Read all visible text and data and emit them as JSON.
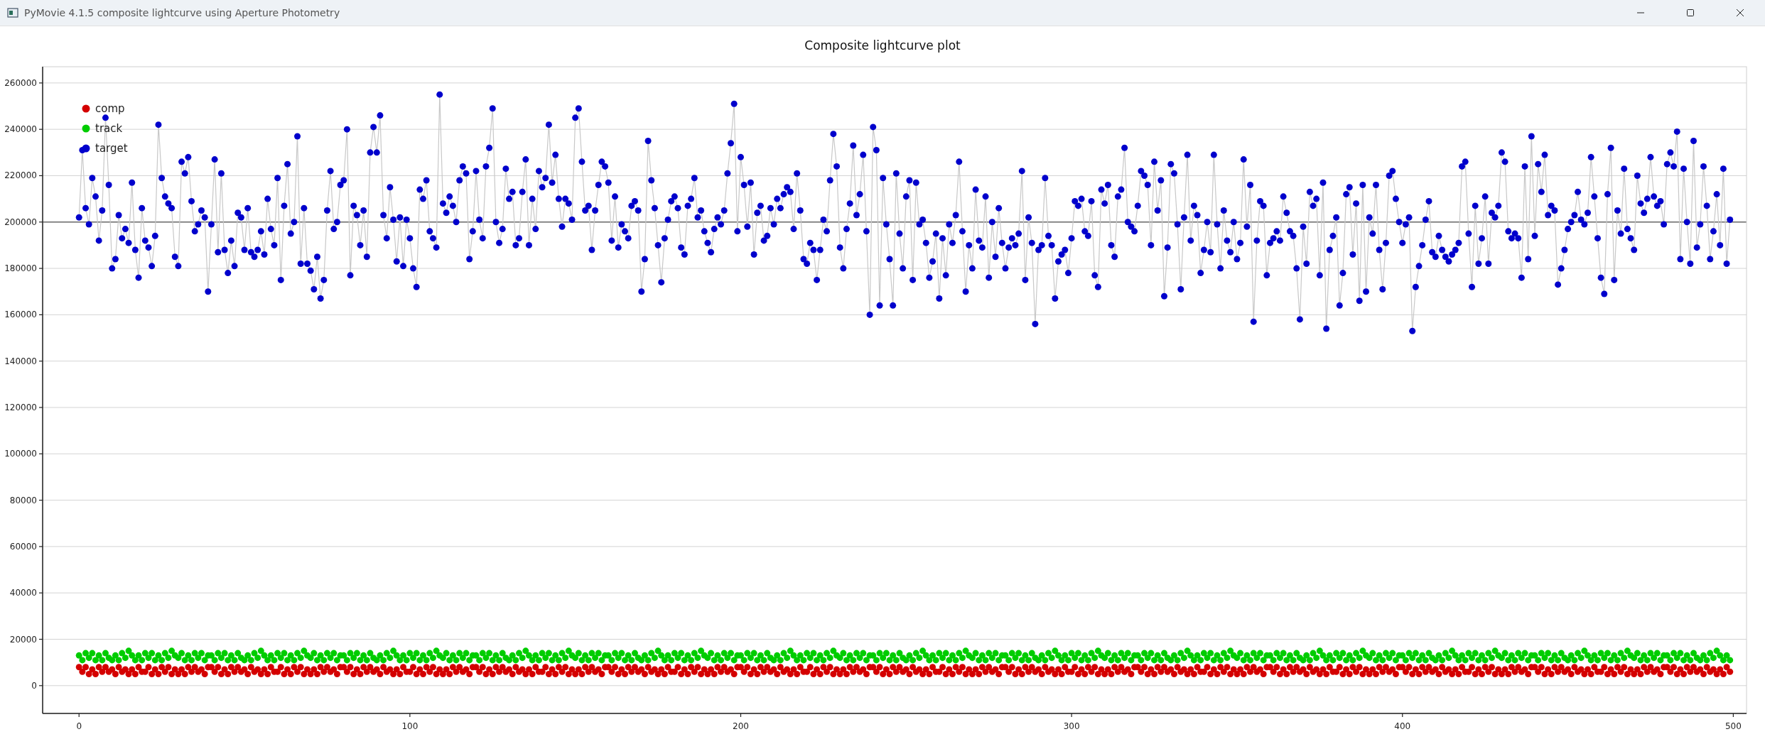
{
  "window": {
    "title": "PyMovie 4.1.5 composite lightcurve using Aperture Photometry"
  },
  "chart": {
    "chart_data": {
      "type": "scatter",
      "title": "Composite lightcurve plot",
      "grid": true,
      "xlim": [
        -11,
        504
      ],
      "ylim": [
        -12000,
        267000
      ],
      "xticks": [
        0,
        100,
        200,
        300,
        400,
        500
      ],
      "yticks": [
        0,
        20000,
        40000,
        60000,
        80000,
        100000,
        120000,
        140000,
        160000,
        180000,
        200000,
        220000,
        240000,
        260000
      ],
      "ref_lines": [
        {
          "axis": "y",
          "value": 200000
        }
      ],
      "legend": true,
      "x": [
        0,
        1,
        2,
        3,
        4,
        5,
        6,
        7,
        8,
        9,
        10,
        11,
        12,
        13,
        14,
        15,
        16,
        17,
        18,
        19,
        20,
        21,
        22,
        23,
        24,
        25,
        26,
        27,
        28,
        29,
        30,
        31,
        32,
        33,
        34,
        35,
        36,
        37,
        38,
        39,
        40,
        41,
        42,
        43,
        44,
        45,
        46,
        47,
        48,
        49,
        50,
        51,
        52,
        53,
        54,
        55,
        56,
        57,
        58,
        59,
        60,
        61,
        62,
        63,
        64,
        65,
        66,
        67,
        68,
        69,
        70,
        71,
        72,
        73,
        74,
        75,
        76,
        77,
        78,
        79,
        80,
        81,
        82,
        83,
        84,
        85,
        86,
        87,
        88,
        89,
        90,
        91,
        92,
        93,
        94,
        95,
        96,
        97,
        98,
        99,
        100,
        101,
        102,
        103,
        104,
        105,
        106,
        107,
        108,
        109,
        110,
        111,
        112,
        113,
        114,
        115,
        116,
        117,
        118,
        119,
        120,
        121,
        122,
        123,
        124,
        125,
        126,
        127,
        128,
        129,
        130,
        131,
        132,
        133,
        134,
        135,
        136,
        137,
        138,
        139,
        140,
        141,
        142,
        143,
        144,
        145,
        146,
        147,
        148,
        149,
        150,
        151,
        152,
        153,
        154,
        155,
        156,
        157,
        158,
        159,
        160,
        161,
        162,
        163,
        164,
        165,
        166,
        167,
        168,
        169,
        170,
        171,
        172,
        173,
        174,
        175,
        176,
        177,
        178,
        179,
        180,
        181,
        182,
        183,
        184,
        185,
        186,
        187,
        188,
        189,
        190,
        191,
        192,
        193,
        194,
        195,
        196,
        197,
        198,
        199,
        200,
        201,
        202,
        203,
        204,
        205,
        206,
        207,
        208,
        209,
        210,
        211,
        212,
        213,
        214,
        215,
        216,
        217,
        218,
        219,
        220,
        221,
        222,
        223,
        224,
        225,
        226,
        227,
        228,
        229,
        230,
        231,
        232,
        233,
        234,
        235,
        236,
        237,
        238,
        239,
        240,
        241,
        242,
        243,
        244,
        245,
        246,
        247,
        248,
        249,
        250,
        251,
        252,
        253,
        254,
        255,
        256,
        257,
        258,
        259,
        260,
        261,
        262,
        263,
        264,
        265,
        266,
        267,
        268,
        269,
        270,
        271,
        272,
        273,
        274,
        275,
        276,
        277,
        278,
        279,
        280,
        281,
        282,
        283,
        284,
        285,
        286,
        287,
        288,
        289,
        290,
        291,
        292,
        293,
        294,
        295,
        296,
        297,
        298,
        299,
        300,
        301,
        302,
        303,
        304,
        305,
        306,
        307,
        308,
        309,
        310,
        311,
        312,
        313,
        314,
        315,
        316,
        317,
        318,
        319,
        320,
        321,
        322,
        323,
        324,
        325,
        326,
        327,
        328,
        329,
        330,
        331,
        332,
        333,
        334,
        335,
        336,
        337,
        338,
        339,
        340,
        341,
        342,
        343,
        344,
        345,
        346,
        347,
        348,
        349,
        350,
        351,
        352,
        353,
        354,
        355,
        356,
        357,
        358,
        359,
        360,
        361,
        362,
        363,
        364,
        365,
        366,
        367,
        368,
        369,
        370,
        371,
        372,
        373,
        374,
        375,
        376,
        377,
        378,
        379,
        380,
        381,
        382,
        383,
        384,
        385,
        386,
        387,
        388,
        389,
        390,
        391,
        392,
        393,
        394,
        395,
        396,
        397,
        398,
        399,
        400,
        401,
        402,
        403,
        404,
        405,
        406,
        407,
        408,
        409,
        410,
        411,
        412,
        413,
        414,
        415,
        416,
        417,
        418,
        419,
        420,
        421,
        422,
        423,
        424,
        425,
        426,
        427,
        428,
        429,
        430,
        431,
        432,
        433,
        434,
        435,
        436,
        437,
        438,
        439,
        440,
        441,
        442,
        443,
        444,
        445,
        446,
        447,
        448,
        449,
        450,
        451,
        452,
        453,
        454,
        455,
        456,
        457,
        458,
        459,
        460,
        461,
        462,
        463,
        464,
        465,
        466,
        467,
        468,
        469,
        470,
        471,
        472,
        473,
        474,
        475,
        476,
        477,
        478,
        479,
        480,
        481,
        482,
        483,
        484,
        485,
        486,
        487,
        488,
        489,
        490,
        491,
        492,
        493,
        494,
        495,
        496,
        497,
        498,
        499
      ],
      "series": [
        {
          "name": "comp",
          "color": "#d40000",
          "type": "scatter",
          "marker": "o",
          "values": [
            8000,
            6000,
            8000,
            5000,
            7000,
            5000,
            8000,
            6000,
            8000,
            6000,
            7000,
            5000,
            8000,
            6000,
            7000,
            5000,
            7000,
            5000,
            8000,
            6000,
            6000,
            8000,
            5000,
            7000,
            5000,
            8000,
            6000,
            8000,
            5000,
            7000,
            5000,
            7000,
            5000,
            8000,
            6000,
            8000,
            6000,
            7000,
            5000,
            8000,
            8000,
            6000,
            8000,
            5000,
            7000,
            5000,
            8000,
            6000,
            8000,
            6000,
            7000,
            5000,
            8000,
            6000,
            7000,
            5000,
            7000,
            5000,
            8000,
            6000,
            6000,
            8000,
            5000,
            7000,
            5000,
            8000,
            6000,
            8000,
            5000,
            7000,
            5000,
            7000,
            5000,
            8000,
            6000,
            8000,
            6000,
            7000,
            5000,
            8000,
            8000,
            6000,
            8000,
            5000,
            7000,
            5000,
            8000,
            6000,
            8000,
            6000,
            7000,
            5000,
            8000,
            6000,
            7000,
            5000,
            7000,
            5000,
            8000,
            6000,
            6000,
            8000,
            5000,
            7000,
            5000,
            8000,
            6000,
            8000,
            5000,
            7000,
            5000,
            7000,
            5000,
            8000,
            6000,
            8000,
            6000,
            7000,
            5000,
            8000,
            8000,
            6000,
            8000,
            5000,
            7000,
            5000,
            8000,
            6000,
            8000,
            6000,
            7000,
            5000,
            8000,
            6000,
            7000,
            5000,
            7000,
            5000,
            8000,
            6000,
            6000,
            8000,
            5000,
            7000,
            5000,
            8000,
            6000,
            8000,
            5000,
            7000,
            5000,
            7000,
            5000,
            8000,
            6000,
            8000,
            6000,
            7000,
            5000,
            8000,
            8000,
            6000,
            8000,
            5000,
            7000,
            5000,
            8000,
            6000,
            8000,
            6000,
            7000,
            5000,
            8000,
            6000,
            7000,
            5000,
            7000,
            5000,
            8000,
            6000,
            6000,
            8000,
            5000,
            7000,
            5000,
            8000,
            6000,
            8000,
            5000,
            7000,
            5000,
            7000,
            5000,
            8000,
            6000,
            8000,
            6000,
            7000,
            5000,
            8000,
            8000,
            6000,
            8000,
            5000,
            7000,
            5000,
            8000,
            6000,
            8000,
            6000,
            7000,
            5000,
            8000,
            6000,
            7000,
            5000,
            7000,
            5000,
            8000,
            6000,
            6000,
            8000,
            5000,
            7000,
            5000,
            8000,
            6000,
            8000,
            5000,
            7000,
            5000,
            7000,
            5000,
            8000,
            6000,
            8000,
            6000,
            7000,
            5000,
            8000,
            8000,
            6000,
            8000,
            5000,
            7000,
            5000,
            8000,
            6000,
            8000,
            6000,
            7000,
            5000,
            8000,
            6000,
            7000,
            5000,
            7000,
            5000,
            8000,
            6000,
            6000,
            8000,
            5000,
            7000,
            5000,
            8000,
            6000,
            8000,
            5000,
            7000,
            5000,
            7000,
            5000,
            8000,
            6000,
            8000,
            6000,
            7000,
            5000,
            8000,
            8000,
            6000,
            8000,
            5000,
            7000,
            5000,
            8000,
            6000,
            8000,
            6000,
            7000,
            5000,
            8000,
            6000,
            7000,
            5000,
            7000,
            5000,
            8000,
            6000,
            6000,
            8000,
            5000,
            7000,
            5000,
            8000,
            6000,
            8000,
            5000,
            7000,
            5000,
            7000,
            5000,
            8000,
            6000,
            8000,
            6000,
            7000,
            5000,
            8000,
            8000,
            6000,
            8000,
            5000,
            7000,
            5000,
            8000,
            6000,
            8000,
            6000,
            7000,
            5000,
            8000,
            6000,
            7000,
            5000,
            7000,
            5000,
            8000,
            6000,
            6000,
            8000,
            5000,
            7000,
            5000,
            8000,
            6000,
            8000,
            5000,
            7000,
            5000,
            7000,
            5000,
            8000,
            6000,
            8000,
            6000,
            7000,
            5000,
            8000,
            8000,
            6000,
            8000,
            5000,
            7000,
            5000,
            8000,
            6000,
            8000,
            6000,
            7000,
            5000,
            8000,
            6000,
            7000,
            5000,
            7000,
            5000,
            8000,
            6000,
            6000,
            8000,
            5000,
            7000,
            5000,
            8000,
            6000,
            8000,
            5000,
            7000,
            5000,
            7000,
            5000,
            8000,
            6000,
            8000,
            6000,
            7000,
            5000,
            8000,
            8000,
            6000,
            8000,
            5000,
            7000,
            5000,
            8000,
            6000,
            8000,
            6000,
            7000,
            5000,
            8000,
            6000,
            7000,
            5000,
            7000,
            5000,
            8000,
            6000,
            6000,
            8000,
            5000,
            7000,
            5000,
            8000,
            6000,
            8000,
            5000,
            7000,
            5000,
            7000,
            5000,
            8000,
            6000,
            8000,
            6000,
            7000,
            5000,
            8000,
            8000,
            6000,
            8000,
            5000,
            7000,
            5000,
            8000,
            6000,
            8000,
            6000,
            7000,
            5000,
            8000,
            6000,
            7000,
            5000,
            7000,
            5000,
            8000,
            6000,
            6000,
            8000,
            5000,
            7000,
            5000,
            8000,
            6000,
            8000,
            5000,
            7000,
            5000,
            7000,
            5000,
            8000,
            6000,
            8000,
            6000,
            7000,
            5000,
            8000,
            8000,
            6000,
            8000,
            5000,
            7000,
            5000,
            8000,
            6000,
            8000,
            6000,
            7000,
            5000,
            8000,
            6000,
            7000,
            5000,
            7000,
            5000,
            8000,
            6000
          ]
        },
        {
          "name": "track",
          "color": "#00cc00",
          "type": "scatter",
          "marker": "o",
          "values": [
            13000,
            11000,
            14000,
            12000,
            14000,
            11000,
            13000,
            11000,
            14000,
            12000,
            11000,
            13000,
            11000,
            14000,
            12000,
            15000,
            13000,
            11000,
            13000,
            11000,
            14000,
            12000,
            14000,
            11000,
            13000,
            11000,
            14000,
            12000,
            15000,
            13000,
            12000,
            14000,
            11000,
            13000,
            11000,
            14000,
            12000,
            14000,
            11000,
            13000,
            13000,
            11000,
            14000,
            12000,
            14000,
            11000,
            13000,
            11000,
            14000,
            12000,
            11000,
            13000,
            11000,
            14000,
            12000,
            15000,
            13000,
            11000,
            13000,
            11000,
            14000,
            12000,
            14000,
            11000,
            13000,
            11000,
            14000,
            12000,
            15000,
            13000,
            12000,
            14000,
            11000,
            13000,
            11000,
            14000,
            12000,
            14000,
            11000,
            13000,
            13000,
            11000,
            14000,
            12000,
            14000,
            11000,
            13000,
            11000,
            14000,
            12000,
            11000,
            13000,
            11000,
            14000,
            12000,
            15000,
            13000,
            11000,
            13000,
            11000,
            14000,
            12000,
            14000,
            11000,
            13000,
            11000,
            14000,
            12000,
            15000,
            13000,
            12000,
            14000,
            11000,
            13000,
            11000,
            14000,
            12000,
            14000,
            11000,
            13000,
            13000,
            11000,
            14000,
            12000,
            14000,
            11000,
            13000,
            11000,
            14000,
            12000,
            11000,
            13000,
            11000,
            14000,
            12000,
            15000,
            13000,
            11000,
            13000,
            11000,
            14000,
            12000,
            14000,
            11000,
            13000,
            11000,
            14000,
            12000,
            15000,
            13000,
            12000,
            14000,
            11000,
            13000,
            11000,
            14000,
            12000,
            14000,
            11000,
            13000,
            13000,
            11000,
            14000,
            12000,
            14000,
            11000,
            13000,
            11000,
            14000,
            12000,
            11000,
            13000,
            11000,
            14000,
            12000,
            15000,
            13000,
            11000,
            13000,
            11000,
            14000,
            12000,
            14000,
            11000,
            13000,
            11000,
            14000,
            12000,
            15000,
            13000,
            12000,
            14000,
            11000,
            13000,
            11000,
            14000,
            12000,
            14000,
            11000,
            13000,
            13000,
            11000,
            14000,
            12000,
            14000,
            11000,
            13000,
            11000,
            14000,
            12000,
            11000,
            13000,
            11000,
            14000,
            12000,
            15000,
            13000,
            11000,
            13000,
            11000,
            14000,
            12000,
            14000,
            11000,
            13000,
            11000,
            14000,
            12000,
            15000,
            13000,
            12000,
            14000,
            11000,
            13000,
            11000,
            14000,
            12000,
            14000,
            11000,
            13000,
            13000,
            11000,
            14000,
            12000,
            14000,
            11000,
            13000,
            11000,
            14000,
            12000,
            11000,
            13000,
            11000,
            14000,
            12000,
            15000,
            13000,
            11000,
            13000,
            11000,
            14000,
            12000,
            14000,
            11000,
            13000,
            11000,
            14000,
            12000,
            15000,
            13000,
            12000,
            14000,
            11000,
            13000,
            11000,
            14000,
            12000,
            14000,
            11000,
            13000,
            13000,
            11000,
            14000,
            12000,
            14000,
            11000,
            13000,
            11000,
            14000,
            12000,
            11000,
            13000,
            11000,
            14000,
            12000,
            15000,
            13000,
            11000,
            13000,
            11000,
            14000,
            12000,
            14000,
            11000,
            13000,
            11000,
            14000,
            12000,
            15000,
            13000,
            12000,
            14000,
            11000,
            13000,
            11000,
            14000,
            12000,
            14000,
            11000,
            13000,
            13000,
            11000,
            14000,
            12000,
            14000,
            11000,
            13000,
            11000,
            14000,
            12000,
            11000,
            13000,
            11000,
            14000,
            12000,
            15000,
            13000,
            11000,
            13000,
            11000,
            14000,
            12000,
            14000,
            11000,
            13000,
            11000,
            14000,
            12000,
            15000,
            13000,
            12000,
            14000,
            11000,
            13000,
            11000,
            14000,
            12000,
            14000,
            11000,
            13000,
            13000,
            11000,
            14000,
            12000,
            14000,
            11000,
            13000,
            11000,
            14000,
            12000,
            11000,
            13000,
            11000,
            14000,
            12000,
            15000,
            13000,
            11000,
            13000,
            11000,
            14000,
            12000,
            14000,
            11000,
            13000,
            11000,
            14000,
            12000,
            15000,
            13000,
            12000,
            14000,
            11000,
            13000,
            11000,
            14000,
            12000,
            14000,
            11000,
            13000,
            13000,
            11000,
            14000,
            12000,
            14000,
            11000,
            13000,
            11000,
            14000,
            12000,
            11000,
            13000,
            11000,
            14000,
            12000,
            15000,
            13000,
            11000,
            13000,
            11000,
            14000,
            12000,
            14000,
            11000,
            13000,
            11000,
            14000,
            12000,
            15000,
            13000,
            12000,
            14000,
            11000,
            13000,
            11000,
            14000,
            12000,
            14000,
            11000,
            13000,
            13000,
            11000,
            14000,
            12000,
            14000,
            11000,
            13000,
            11000,
            14000,
            12000,
            11000,
            13000,
            11000,
            14000,
            12000,
            15000,
            13000,
            11000,
            13000,
            11000,
            14000,
            12000,
            14000,
            11000,
            13000,
            11000,
            14000,
            12000,
            15000,
            13000,
            12000,
            14000,
            11000,
            13000,
            11000,
            14000,
            12000,
            14000,
            11000,
            13000,
            13000,
            11000,
            14000,
            12000,
            14000,
            11000,
            13000,
            11000,
            14000,
            12000,
            11000,
            13000,
            11000,
            14000,
            12000,
            15000,
            13000,
            11000,
            13000,
            11000
          ]
        },
        {
          "name": "target",
          "color": "#0000cc",
          "type": "line",
          "marker": "o",
          "values": [
            202000,
            231000,
            206000,
            199000,
            219000,
            211000,
            192000,
            205000,
            245000,
            216000,
            180000,
            184000,
            203000,
            193000,
            197000,
            191000,
            217000,
            188000,
            176000,
            206000,
            192000,
            189000,
            181000,
            194000,
            242000,
            219000,
            211000,
            208000,
            206000,
            185000,
            181000,
            226000,
            221000,
            228000,
            209000,
            196000,
            199000,
            205000,
            202000,
            170000,
            199000,
            227000,
            187000,
            221000,
            188000,
            178000,
            192000,
            181000,
            204000,
            202000,
            188000,
            206000,
            187000,
            185000,
            188000,
            196000,
            186000,
            210000,
            197000,
            190000,
            219000,
            175000,
            207000,
            225000,
            195000,
            200000,
            237000,
            182000,
            206000,
            182000,
            179000,
            171000,
            185000,
            167000,
            175000,
            205000,
            222000,
            197000,
            200000,
            216000,
            218000,
            240000,
            177000,
            207000,
            203000,
            190000,
            205000,
            185000,
            230000,
            241000,
            230000,
            246000,
            203000,
            193000,
            215000,
            201000,
            183000,
            202000,
            181000,
            201000,
            193000,
            180000,
            172000,
            214000,
            210000,
            218000,
            196000,
            193000,
            189000,
            255000,
            208000,
            204000,
            211000,
            207000,
            200000,
            218000,
            224000,
            221000,
            184000,
            196000,
            222000,
            201000,
            193000,
            224000,
            232000,
            249000,
            200000,
            191000,
            197000,
            223000,
            210000,
            213000,
            190000,
            193000,
            213000,
            227000,
            190000,
            210000,
            197000,
            222000,
            215000,
            219000,
            242000,
            217000,
            229000,
            210000,
            198000,
            210000,
            208000,
            201000,
            245000,
            249000,
            226000,
            205000,
            207000,
            188000,
            205000,
            216000,
            226000,
            224000,
            217000,
            192000,
            211000,
            189000,
            199000,
            196000,
            193000,
            207000,
            209000,
            205000,
            170000,
            184000,
            235000,
            218000,
            206000,
            190000,
            174000,
            193000,
            201000,
            209000,
            211000,
            206000,
            189000,
            186000,
            207000,
            210000,
            219000,
            202000,
            205000,
            196000,
            191000,
            187000,
            197000,
            202000,
            199000,
            205000,
            221000,
            234000,
            251000,
            196000,
            228000,
            216000,
            198000,
            217000,
            186000,
            204000,
            207000,
            192000,
            194000,
            206000,
            199000,
            210000,
            206000,
            212000,
            215000,
            213000,
            197000,
            221000,
            205000,
            184000,
            182000,
            191000,
            188000,
            175000,
            188000,
            201000,
            196000,
            218000,
            238000,
            224000,
            189000,
            180000,
            197000,
            208000,
            233000,
            203000,
            212000,
            229000,
            196000,
            160000,
            241000,
            231000,
            164000,
            219000,
            199000,
            184000,
            164000,
            221000,
            195000,
            180000,
            211000,
            218000,
            175000,
            217000,
            199000,
            201000,
            191000,
            176000,
            183000,
            195000,
            167000,
            193000,
            177000,
            199000,
            191000,
            203000,
            226000,
            196000,
            170000,
            190000,
            180000,
            214000,
            192000,
            189000,
            211000,
            176000,
            200000,
            185000,
            206000,
            191000,
            180000,
            189000,
            193000,
            190000,
            195000,
            222000,
            175000,
            202000,
            191000,
            156000,
            188000,
            190000,
            219000,
            194000,
            190000,
            167000,
            183000,
            186000,
            188000,
            178000,
            193000,
            209000,
            207000,
            210000,
            196000,
            194000,
            209000,
            177000,
            172000,
            214000,
            208000,
            216000,
            190000,
            185000,
            211000,
            214000,
            232000,
            200000,
            198000,
            196000,
            207000,
            222000,
            220000,
            216000,
            190000,
            226000,
            205000,
            218000,
            168000,
            189000,
            225000,
            221000,
            199000,
            171000,
            202000,
            229000,
            192000,
            207000,
            203000,
            178000,
            188000,
            200000,
            187000,
            229000,
            199000,
            180000,
            205000,
            192000,
            187000,
            200000,
            184000,
            191000,
            227000,
            198000,
            216000,
            157000,
            192000,
            209000,
            207000,
            177000,
            191000,
            193000,
            196000,
            192000,
            211000,
            204000,
            196000,
            194000,
            180000,
            158000,
            198000,
            182000,
            213000,
            207000,
            210000,
            177000,
            217000,
            154000,
            188000,
            194000,
            202000,
            164000,
            178000,
            212000,
            215000,
            186000,
            208000,
            166000,
            216000,
            170000,
            202000,
            195000,
            216000,
            188000,
            171000,
            191000,
            220000,
            222000,
            210000,
            200000,
            191000,
            199000,
            202000,
            153000,
            172000,
            181000,
            190000,
            201000,
            209000,
            187000,
            185000,
            194000,
            188000,
            185000,
            183000,
            186000,
            188000,
            191000,
            224000,
            226000,
            195000,
            172000,
            207000,
            182000,
            193000,
            211000,
            182000,
            204000,
            202000,
            207000,
            230000,
            226000,
            196000,
            193000,
            195000,
            193000,
            176000,
            224000,
            184000,
            237000,
            194000,
            225000,
            213000,
            229000,
            203000,
            207000,
            205000,
            173000,
            180000,
            188000,
            197000,
            200000,
            203000,
            213000,
            201000,
            199000,
            204000,
            228000,
            211000,
            193000,
            176000,
            169000,
            212000,
            232000,
            175000,
            205000,
            195000,
            223000,
            197000,
            193000,
            188000,
            220000,
            208000,
            204000,
            210000,
            228000,
            211000,
            207000,
            209000,
            199000,
            225000,
            230000,
            224000,
            239000,
            184000,
            223000,
            200000,
            182000,
            235000,
            189000,
            199000,
            224000,
            207000,
            184000,
            196000,
            212000,
            190000,
            223000,
            182000,
            201000
          ]
        }
      ]
    }
  }
}
